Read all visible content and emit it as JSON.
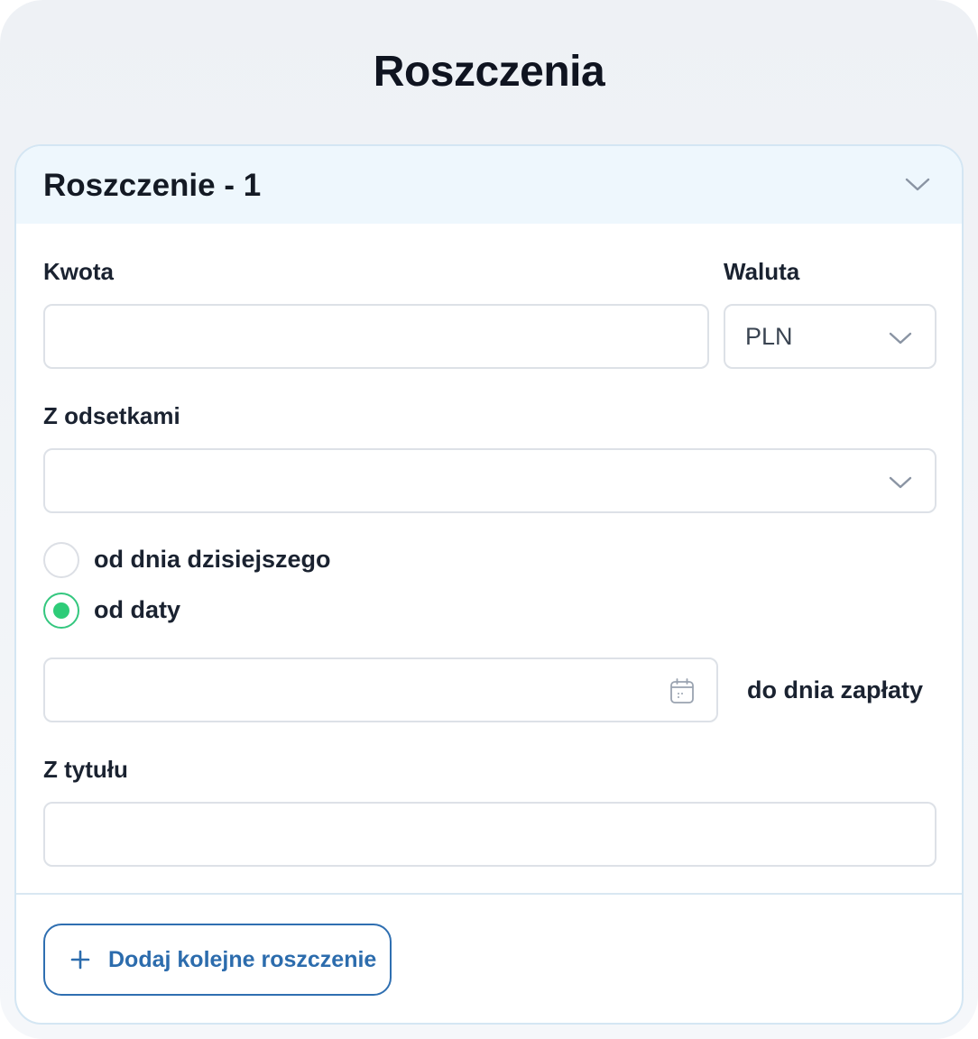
{
  "page": {
    "title": "Roszczenia"
  },
  "claim": {
    "title": "Roszczenie - 1",
    "amount": {
      "label": "Kwota",
      "value": ""
    },
    "currency": {
      "label": "Waluta",
      "selected": "PLN"
    },
    "interest": {
      "label": "Z odsetkami",
      "selected": ""
    },
    "radio_options": [
      {
        "label": "od dnia dzisiejszego",
        "checked": false
      },
      {
        "label": "od daty",
        "checked": true
      }
    ],
    "date": {
      "value": ""
    },
    "until_label": "do dnia zapłaty",
    "title_field": {
      "label": "Z tytułu",
      "value": ""
    }
  },
  "actions": {
    "add_label": "Dodaj kolejne roszczenie"
  },
  "colors": {
    "accent": "#2c6cad",
    "radio_checked": "#2ecc78",
    "header_bg": "#eef7fd"
  }
}
